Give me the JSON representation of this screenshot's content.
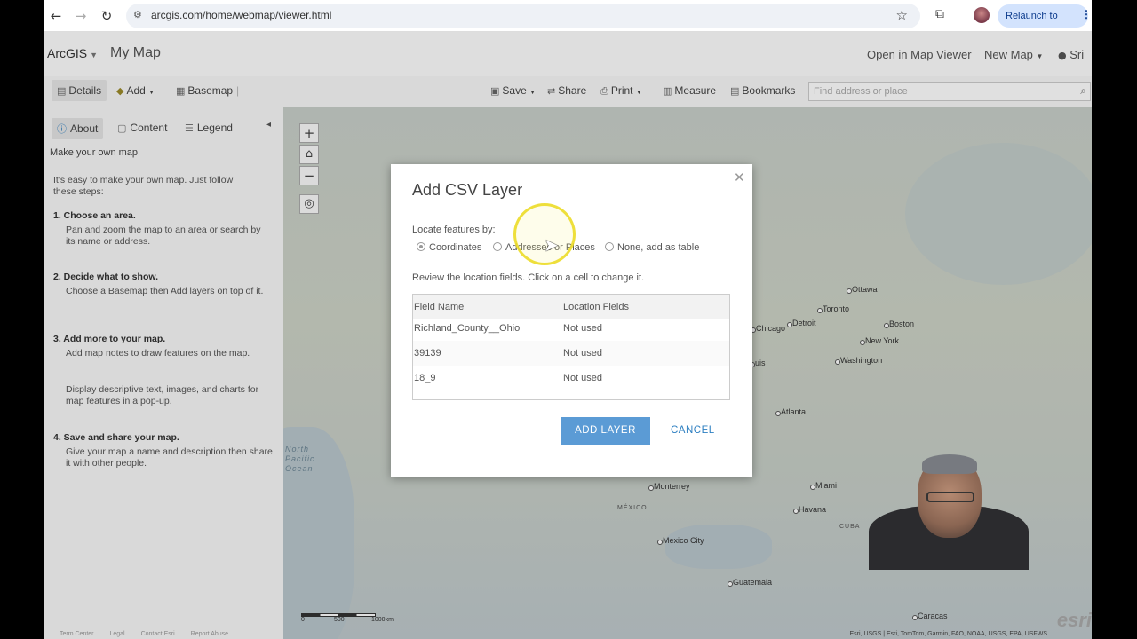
{
  "browser": {
    "url": "arcgis.com/home/webmap/viewer.html",
    "relaunch_label": "Relaunch to update"
  },
  "app": {
    "brand": "ArcGIS",
    "map_name": "My Map",
    "header_links": [
      "Open in Map Viewer",
      "New Map",
      "Sri"
    ]
  },
  "toolbar": {
    "details": "Details",
    "add": "Add",
    "basemap": "Basemap",
    "save": "Save",
    "share": "Share",
    "print": "Print",
    "measure": "Measure",
    "bookmarks": "Bookmarks",
    "search_placeholder": "Find address or place"
  },
  "panel": {
    "tabs": [
      "About",
      "Content",
      "Legend"
    ],
    "heading": "Make your own map",
    "intro": "It's easy to make your own map. Just follow these steps:",
    "steps": [
      {
        "title": "1. Choose an area.",
        "text": "Pan and zoom the map to an area or search by its name or address."
      },
      {
        "title": "2. Decide what to show.",
        "text": "Choose a Basemap then Add layers on top of it."
      },
      {
        "title": "3. Add more to your map.",
        "text": "Add map notes to draw features on the map.",
        "text2": "Display descriptive text, images, and charts for map features in a pop-up."
      },
      {
        "title": "4. Save and share your map.",
        "text": "Give your map a name and description then share it with other people."
      }
    ],
    "footer": [
      "Term Center",
      "Legal",
      "Contact Esri",
      "Report Abuse"
    ]
  },
  "map": {
    "cities": [
      "Ottawa",
      "Toronto",
      "Boston",
      "Detroit",
      "Chicago",
      "New York",
      "Washington",
      "Atlanta",
      "Miami",
      "Havana",
      "Monterrey",
      "Mexico City",
      "Guatemala",
      "Caracas",
      "uis"
    ],
    "countries": [
      "MÉXICO",
      "CUBA"
    ],
    "ocean": "North Pacific Ocean",
    "scale_labels": [
      "0",
      "500",
      "1000km"
    ],
    "attribution": "Esri, USGS | Esri, TomTom, Garmin, FAO, NOAA, USGS, EPA, USFWS",
    "logo": "esri"
  },
  "dialog": {
    "title": "Add CSV Layer",
    "locate_label": "Locate features by:",
    "radios": [
      "Coordinates",
      "Addresses or Places",
      "None, add as table"
    ],
    "selected_radio": "Coordinates",
    "review_text": "Review the location fields. Click on a cell to change it.",
    "table": {
      "headers": [
        "Field Name",
        "Location Fields"
      ],
      "rows": [
        [
          "Richland_County__Ohio",
          "Not used"
        ],
        [
          "39139",
          "Not used"
        ],
        [
          "18_9",
          "Not used"
        ]
      ]
    },
    "add_button": "ADD LAYER",
    "cancel_button": "CANCEL"
  }
}
